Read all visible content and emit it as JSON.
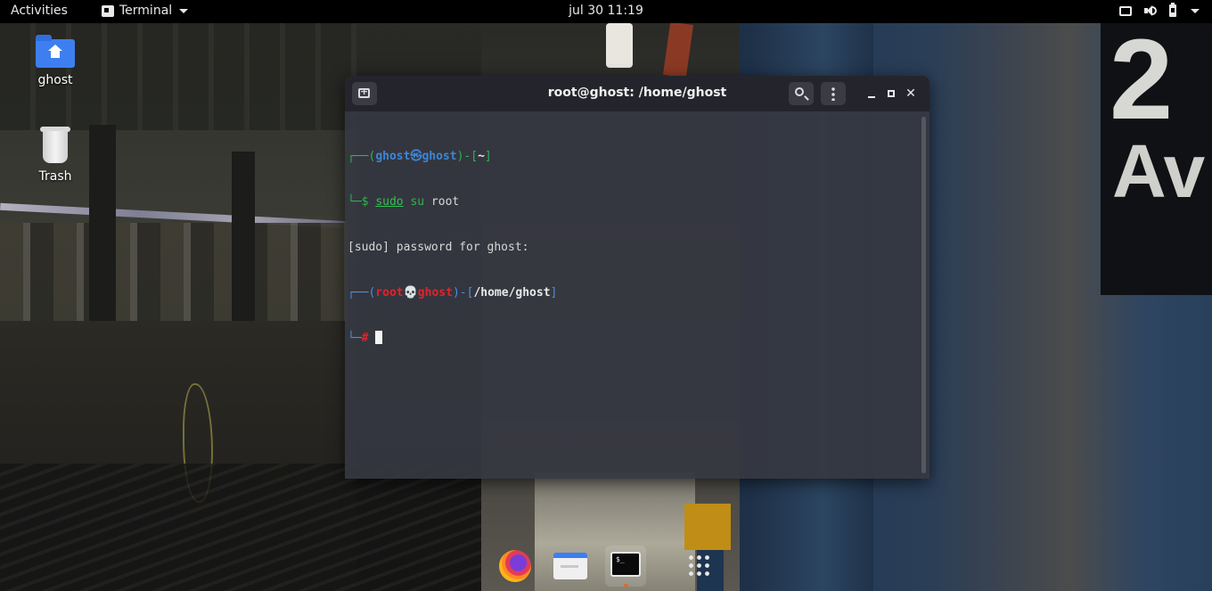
{
  "topbar": {
    "activities": "Activities",
    "app_menu": "Terminal",
    "clock": "jul 30  11:19"
  },
  "desktop": {
    "home_label": "ghost",
    "trash_label": "Trash"
  },
  "terminal": {
    "title": "root@ghost: /home/ghost",
    "lines": {
      "l1": {
        "open": "┌──(",
        "user": "ghost㉿ghost",
        "close": ")-[",
        "path": "~",
        "end": "]"
      },
      "l2": {
        "prompt": "└─$ ",
        "cmd": "sudo",
        "args": " su",
        "rest": " root"
      },
      "l3": {
        "text": "[sudo] password for ghost:"
      },
      "l4": {
        "open": "┌──(",
        "user": "root💀ghost",
        "close": ")-[",
        "path": "/home/ghost",
        "end": "]"
      },
      "l5": {
        "prompt": "└─",
        "hash": "#",
        "space": " "
      }
    }
  },
  "dock": {
    "items": [
      "firefox-icon",
      "files-icon",
      "terminal-icon",
      "app-grid-icon"
    ],
    "terminal_glyph": "$_"
  },
  "colors": {
    "terminal_bg": "#363842",
    "titlebar_bg": "#24252c",
    "prompt_green": "#2fb44c",
    "prompt_blue": "#3d86d6",
    "root_red": "#e0242a"
  }
}
